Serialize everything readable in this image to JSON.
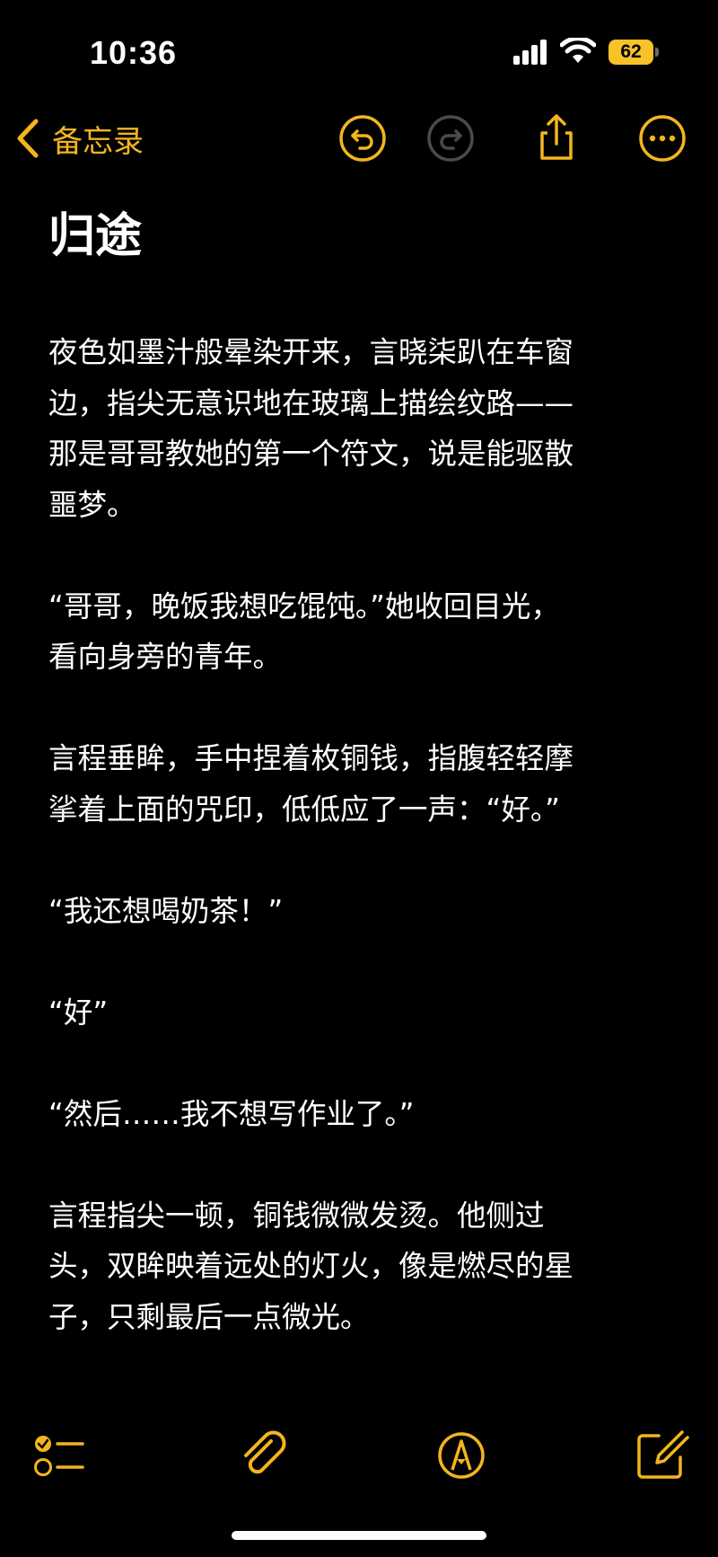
{
  "status_bar": {
    "time": "10:36",
    "battery_level": "62",
    "signal": "cellular-signal-icon",
    "wifi": "wifi-icon"
  },
  "nav": {
    "back_label": "备忘录",
    "accent_color": "#f2b51e",
    "undo_icon": "undo-icon",
    "redo_icon": "redo-icon",
    "share_icon": "share-icon",
    "more_icon": "more-icon"
  },
  "note": {
    "title": "归途",
    "paragraphs": [
      "夜色如墨汁般晕染开来，言晓柒趴在车窗\n边，指尖无意识地在玻璃上描绘纹路——\n那是哥哥教她的第一个符文，说是能驱散\n噩梦。",
      "“哥哥，晚饭我想吃馄饨。”她收回目光，\n看向身旁的青年。",
      "言程垂眸，手中捏着枚铜钱，指腹轻轻摩\n挲着上面的咒印，低低应了一声：“好。”",
      "“我还想喝奶茶！”",
      "“好”",
      "“然后……我不想写作业了。”",
      "言程指尖一顿，铜钱微微发烫。他侧过\n头，双眸映着远处的灯火，像是燃尽的星\n子，只剩最后一点微光。"
    ]
  },
  "toolbar": {
    "checklist_icon": "checklist-icon",
    "attachment_icon": "paperclip-icon",
    "markup_icon": "markup-pen-icon",
    "compose_icon": "compose-icon"
  }
}
